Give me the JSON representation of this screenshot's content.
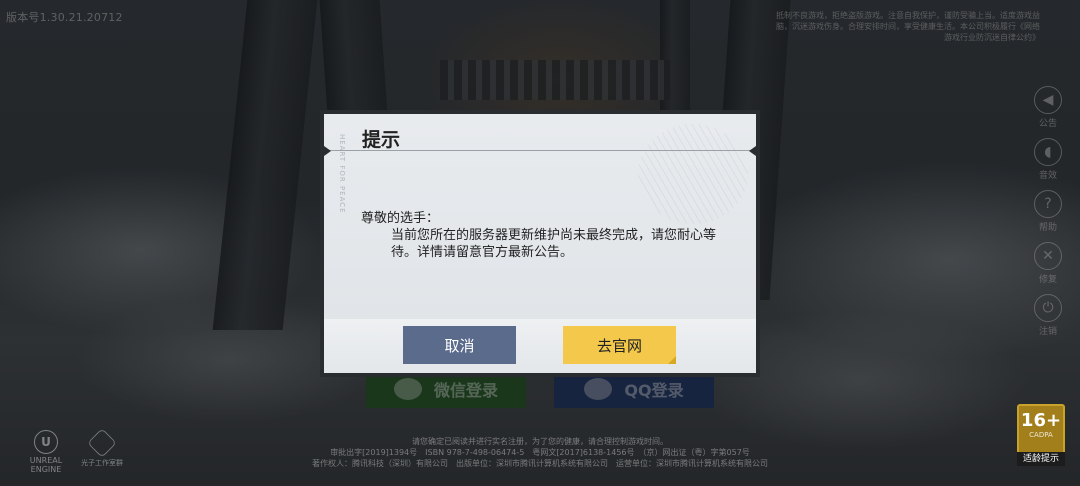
{
  "header": {
    "version": "版本号1.30.21.20712",
    "health_notice": "抵制不良游戏，拒绝盗版游戏。注意自我保护，谨防受骗上当。适度游戏益脑，沉迷游戏伤身。合理安排时间，享受健康生活。本公司积极履行《网络游戏行业防沉迷自律公约》"
  },
  "side_menu": [
    {
      "label": "公告",
      "icon": "megaphone-icon",
      "glyph": "◀"
    },
    {
      "label": "音效",
      "icon": "speaker-icon",
      "glyph": "◖"
    },
    {
      "label": "帮助",
      "icon": "help-icon",
      "glyph": "?"
    },
    {
      "label": "修复",
      "icon": "repair-icon",
      "glyph": "✕"
    },
    {
      "label": "注销",
      "icon": "power-icon",
      "glyph": "⏻"
    }
  ],
  "login": {
    "wechat_label": "微信登录",
    "qq_label": "QQ登录"
  },
  "footer": {
    "line1": "请您确定已阅读并进行实名注册，为了您的健康，请合理控制游戏时间。",
    "line2": "审批出字[2019]1394号　ISBN 978-7-498-06474-5　粤网文[2017]6138-1456号　（京）网出证（粤）字第057号",
    "line3": "著作权人：腾讯科技（深圳）有限公司　出版单位：深圳市腾讯计算机系统有限公司　运营单位：深圳市腾讯计算机系统有限公司"
  },
  "logos": {
    "unreal": "UNREAL",
    "unreal_sub": "ENGINE",
    "studio": "光子工作室群"
  },
  "age_badge": {
    "rating": "16+",
    "cadpa": "CADPA",
    "label": "适龄提示"
  },
  "dialog": {
    "title": "提示",
    "greeting": "尊敬的选手：",
    "message": "当前您所在的服务器更新维护尚未最终完成，请您耐心等待。详情请留意官方最新公告。",
    "side_text": "HEART FOR PEACE",
    "cancel_label": "取消",
    "official_label": "去官网"
  },
  "colors": {
    "cancel_button": "#5b6b8c",
    "official_button": "#f4c84a",
    "age_badge": "#a37f1c"
  }
}
